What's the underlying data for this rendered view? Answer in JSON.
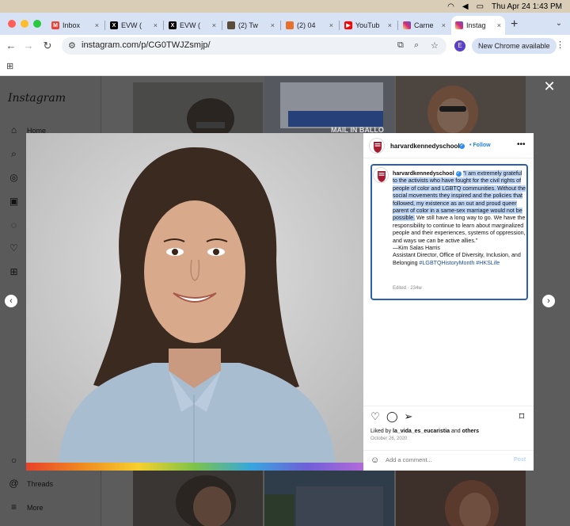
{
  "menubar": {
    "datetime": "Thu Apr 24  1:43 PM"
  },
  "tabs": [
    {
      "label": "Inbox",
      "favicon": "gmail-icon",
      "color": "#ea4335",
      "glyph": "M"
    },
    {
      "label": "EVW (",
      "favicon": "x-icon",
      "color": "#000000",
      "glyph": "X"
    },
    {
      "label": "EVW (",
      "favicon": "x-icon",
      "color": "#000000",
      "glyph": "X"
    },
    {
      "label": "(2) Tw",
      "favicon": "site-icon",
      "color": "#5a4a3a",
      "glyph": ""
    },
    {
      "label": "(2) 04",
      "favicon": "site-icon",
      "color": "#e8702a",
      "glyph": ""
    },
    {
      "label": "YouTub",
      "favicon": "youtube-icon",
      "color": "#ff0000",
      "glyph": "▶"
    },
    {
      "label": "Carne",
      "favicon": "instagram-icon",
      "color": "#d62976",
      "glyph": ""
    },
    {
      "label": "Instag",
      "favicon": "instagram-icon",
      "color": "#d62976",
      "glyph": ""
    }
  ],
  "address_bar": {
    "url": "instagram.com/p/CG0TWJZsmjp/"
  },
  "profile_initial": "E",
  "new_chrome_label": "New Chrome available",
  "sidebar": {
    "logo": "Instagram",
    "items": [
      {
        "label": "Home",
        "icon": "home-icon"
      },
      {
        "label": "Threads",
        "icon": "threads-icon"
      },
      {
        "label": "More",
        "icon": "menu-icon"
      }
    ]
  },
  "background_tiles": {
    "banner_text": "MAIL IN BALLO"
  },
  "post": {
    "username": "harvardkennedyschool",
    "follow_label": "Follow",
    "caption_highlighted": "\"I am extremely grateful to the activists who have fought for the civil rights of people of color and LGBTQ communities. Without the social movements they inspired and the policies that followed, my existence as an out and proud queer parent of color in a same-sex marriage would not be possible.",
    "caption_rest": " We still have a long way to go. We have the responsibility to continue to learn about marginalized people and their experiences, systems of oppression, and ways we can be active allies.\"",
    "caption_author": "—Kim Salas Harris",
    "caption_title": "Assistant Director, Office of Diversity, Inclusion, and Belonging ",
    "hashtags": "#LGBTQHistoryMonth #HKSLife",
    "edited": "Edited · 234w",
    "liked_prefix": "Liked by ",
    "liked_user": "la_vida_es_eucaristia",
    "liked_mid": " and ",
    "liked_others": "others",
    "date": "October 26, 2020",
    "comment_placeholder": "Add a comment...",
    "post_label": "Post"
  },
  "colors": {
    "accent_blue": "#1f7fe0",
    "highlight": "#bcd4f5",
    "selection_border": "#2c5fae"
  }
}
